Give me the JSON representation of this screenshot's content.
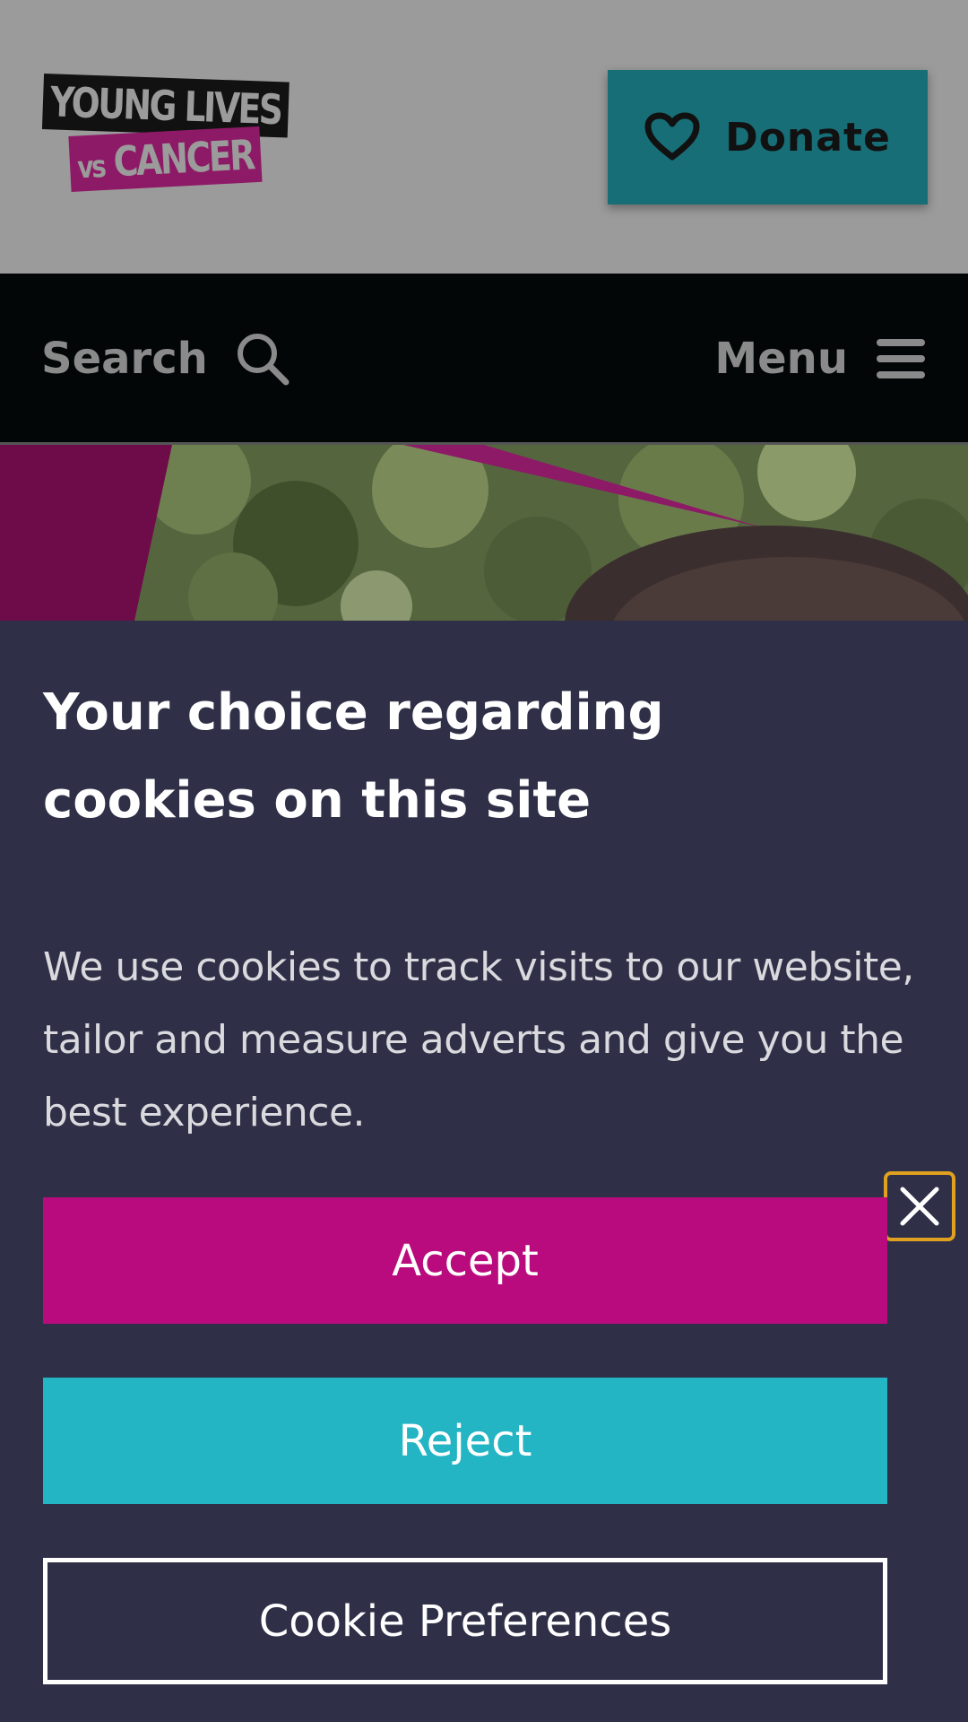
{
  "header": {
    "logo": {
      "line1": "YOUNG LIVES",
      "line2_prefix": "vs",
      "line2_main": "CANCER"
    },
    "donate_label": "Donate"
  },
  "nav": {
    "search_label": "Search",
    "menu_label": "Menu"
  },
  "cookie_banner": {
    "title": "Your choice regarding cookies on this site",
    "body": "We use cookies to track visits to our website, tailor and measure adverts and give you the best experience.",
    "accept_label": "Accept",
    "reject_label": "Reject",
    "preferences_label": "Cookie Preferences"
  },
  "colors": {
    "accept": "#b90b7d",
    "reject": "#23b5c4",
    "donate": "#176e76",
    "banner_bg": "#2f3047",
    "close_focus": "#e0a020"
  },
  "icons": {
    "donate": "heart-icon",
    "search": "search-icon",
    "menu": "hamburger-icon",
    "close": "close-icon"
  }
}
